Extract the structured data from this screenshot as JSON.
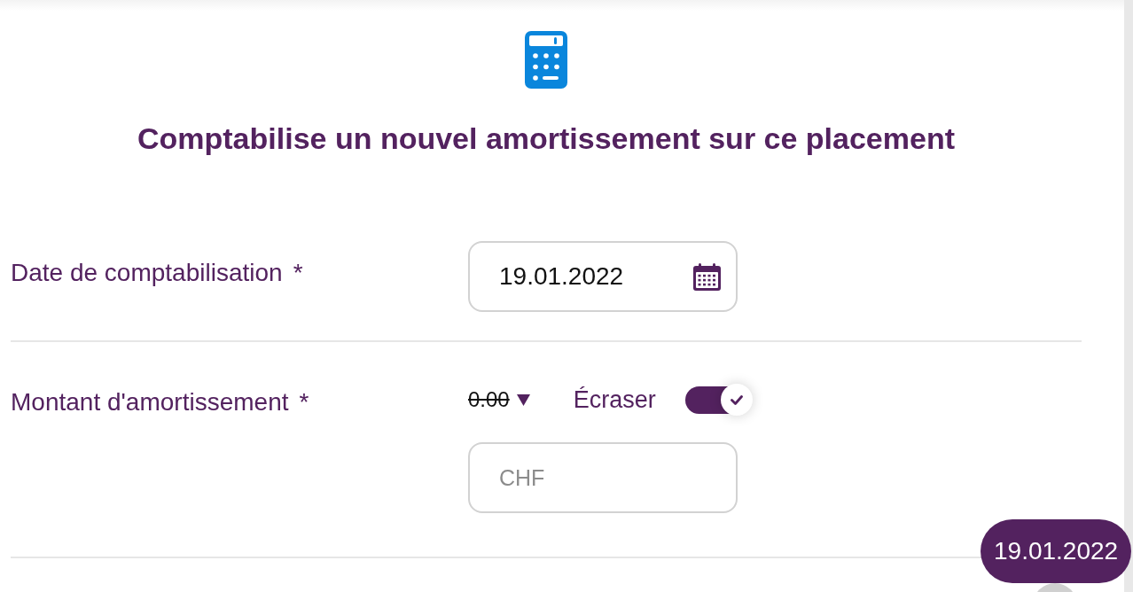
{
  "header": {
    "title": "Comptabilise un nouvel amortissement sur ce placement"
  },
  "fields": [
    {
      "kind": "date",
      "label": "Date de comptabilisation",
      "required_mark": "*",
      "value": "19.01.2022"
    },
    {
      "kind": "amount",
      "label": "Montant d'amortissement",
      "required_mark": "*",
      "previous_value": "0.00",
      "override": {
        "label": "Écraser",
        "on": true
      },
      "placeholder": "CHF"
    }
  ],
  "date_badge": "19.01.2022"
}
